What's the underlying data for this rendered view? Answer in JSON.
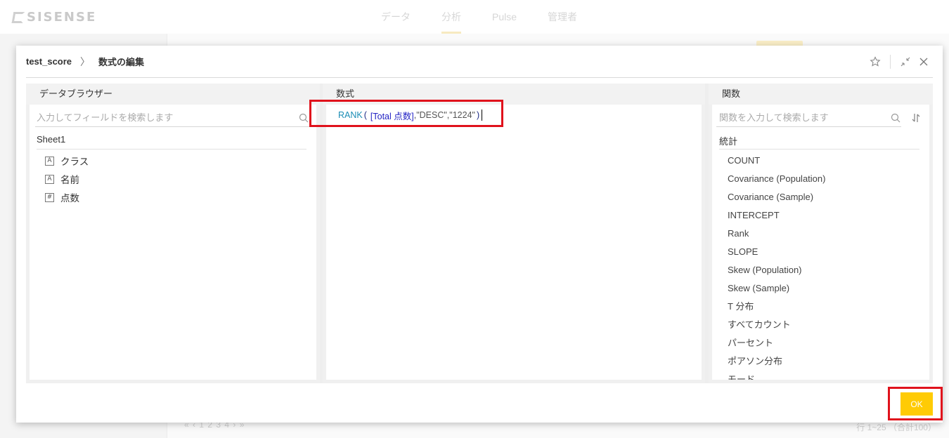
{
  "app": {
    "logo_text": "SISENSE",
    "nav": [
      {
        "label": "データ"
      },
      {
        "label": "分析"
      },
      {
        "label": "Pulse"
      },
      {
        "label": "管理者"
      }
    ],
    "pager": "« ‹ 1 2 3 4 › »",
    "row_count": "行 1~25 （合計100）"
  },
  "modal": {
    "breadcrumb_root": "test_score",
    "breadcrumb_sep": "〉",
    "breadcrumb_page": "数式の編集",
    "data_browser": {
      "title": "データブラウザー",
      "search_placeholder": "入力してフィールドを検索します",
      "table_name": "Sheet1",
      "fields": [
        {
          "type": "A",
          "label": "クラス"
        },
        {
          "type": "A",
          "label": "名前"
        },
        {
          "type": "#",
          "label": "点数"
        }
      ]
    },
    "formula": {
      "title": "数式",
      "fn": "RANK",
      "open": "(",
      "field": "[Total 点数]",
      "args": " ,\"DESC\",\"1224\"",
      "close": ")"
    },
    "functions": {
      "title": "関数",
      "search_placeholder": "関数を入力して検索します",
      "group": "統計",
      "items": [
        "COUNT",
        "Covariance (Population)",
        "Covariance (Sample)",
        "INTERCEPT",
        "Rank",
        "SLOPE",
        "Skew (Population)",
        "Skew (Sample)",
        "T 分布",
        "すべてカウント",
        "パーセント",
        "ポアソン分布",
        "モード"
      ]
    },
    "ok_label": "OK",
    "accent": "#ffcb05",
    "highlight_color": "#e0121c"
  }
}
